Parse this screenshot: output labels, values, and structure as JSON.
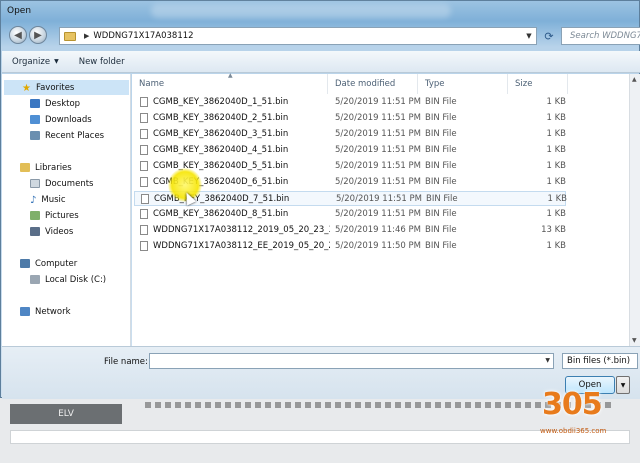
{
  "window": {
    "title": "Open"
  },
  "address_bar": {
    "path": "WDDNG71X17A038112",
    "search_placeholder": "Search WDDNG71..."
  },
  "toolbar": {
    "organize": "Organize",
    "new_folder": "New folder"
  },
  "nav_pane": {
    "items": [
      {
        "label": "Favorites",
        "selected": true,
        "icon": "star-icon"
      },
      {
        "label": "Desktop",
        "icon": "desktop-icon"
      },
      {
        "label": "Downloads",
        "icon": "downloads-icon"
      },
      {
        "label": "Recent Places",
        "icon": "recent-places-icon"
      },
      {
        "label": "Libraries",
        "icon": "libraries-icon"
      },
      {
        "label": "Documents",
        "icon": "documents-icon"
      },
      {
        "label": "Music",
        "icon": "music-icon"
      },
      {
        "label": "Pictures",
        "icon": "pictures-icon"
      },
      {
        "label": "Videos",
        "icon": "videos-icon"
      },
      {
        "label": "Computer",
        "icon": "computer-icon"
      },
      {
        "label": "Local Disk (C:)",
        "icon": "local-disk-icon"
      },
      {
        "label": "Network",
        "icon": "network-icon"
      }
    ]
  },
  "columns": {
    "name": "Name",
    "date": "Date modified",
    "type": "Type",
    "size": "Size"
  },
  "files": [
    {
      "name": "CGMB_KEY_3862040D_1_51.bin",
      "date": "5/20/2019 11:51 PM",
      "type": "BIN File",
      "size": "1 KB"
    },
    {
      "name": "CGMB_KEY_3862040D_2_51.bin",
      "date": "5/20/2019 11:51 PM",
      "type": "BIN File",
      "size": "1 KB"
    },
    {
      "name": "CGMB_KEY_3862040D_3_51.bin",
      "date": "5/20/2019 11:51 PM",
      "type": "BIN File",
      "size": "1 KB"
    },
    {
      "name": "CGMB_KEY_3862040D_4_51.bin",
      "date": "5/20/2019 11:51 PM",
      "type": "BIN File",
      "size": "1 KB"
    },
    {
      "name": "CGMB_KEY_3862040D_5_51.bin",
      "date": "5/20/2019 11:51 PM",
      "type": "BIN File",
      "size": "1 KB"
    },
    {
      "name": "CGMB_KEY_3862040D_6_51.bin",
      "date": "5/20/2019 11:51 PM",
      "type": "BIN File",
      "size": "1 KB"
    },
    {
      "name": "CGMB_KEY_3862040D_7_51.bin",
      "date": "5/20/2019 11:51 PM",
      "type": "BIN File",
      "size": "1 KB"
    },
    {
      "name": "CGMB_KEY_3862040D_8_51.bin",
      "date": "5/20/2019 11:51 PM",
      "type": "BIN File",
      "size": "1 KB"
    },
    {
      "name": "WDDNG71X17A038112_2019_05_20_23_35...",
      "date": "5/20/2019 11:46 PM",
      "type": "BIN File",
      "size": "13 KB"
    },
    {
      "name": "WDDNG71X17A038112_EE_2019_05_20_23...",
      "date": "5/20/2019 11:50 PM",
      "type": "BIN File",
      "size": "1 KB"
    }
  ],
  "bottom": {
    "file_name_label": "File name:",
    "file_name_value": "",
    "file_type": "Bin files (*.bin)",
    "open_label": "Open"
  },
  "background_app": {
    "tab_label": "ELV"
  },
  "watermark": {
    "logo": "305",
    "url": "www.obdii365.com"
  }
}
